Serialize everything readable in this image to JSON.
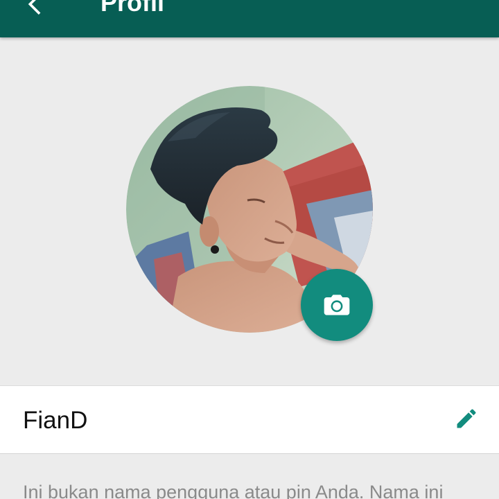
{
  "appbar": {
    "title": "Profil",
    "back_icon": "arrow-back-icon",
    "color": "#075e54"
  },
  "profile": {
    "avatar_description": "profile-photo",
    "camera_icon": "camera-icon",
    "camera_button_color": "#128c7e",
    "name": "FianD",
    "edit_icon": "pencil-icon",
    "helper_text": "Ini bukan nama pengguna atau pin Anda. Nama ini"
  },
  "colors": {
    "accent": "#128c7e",
    "background": "#ececec"
  }
}
